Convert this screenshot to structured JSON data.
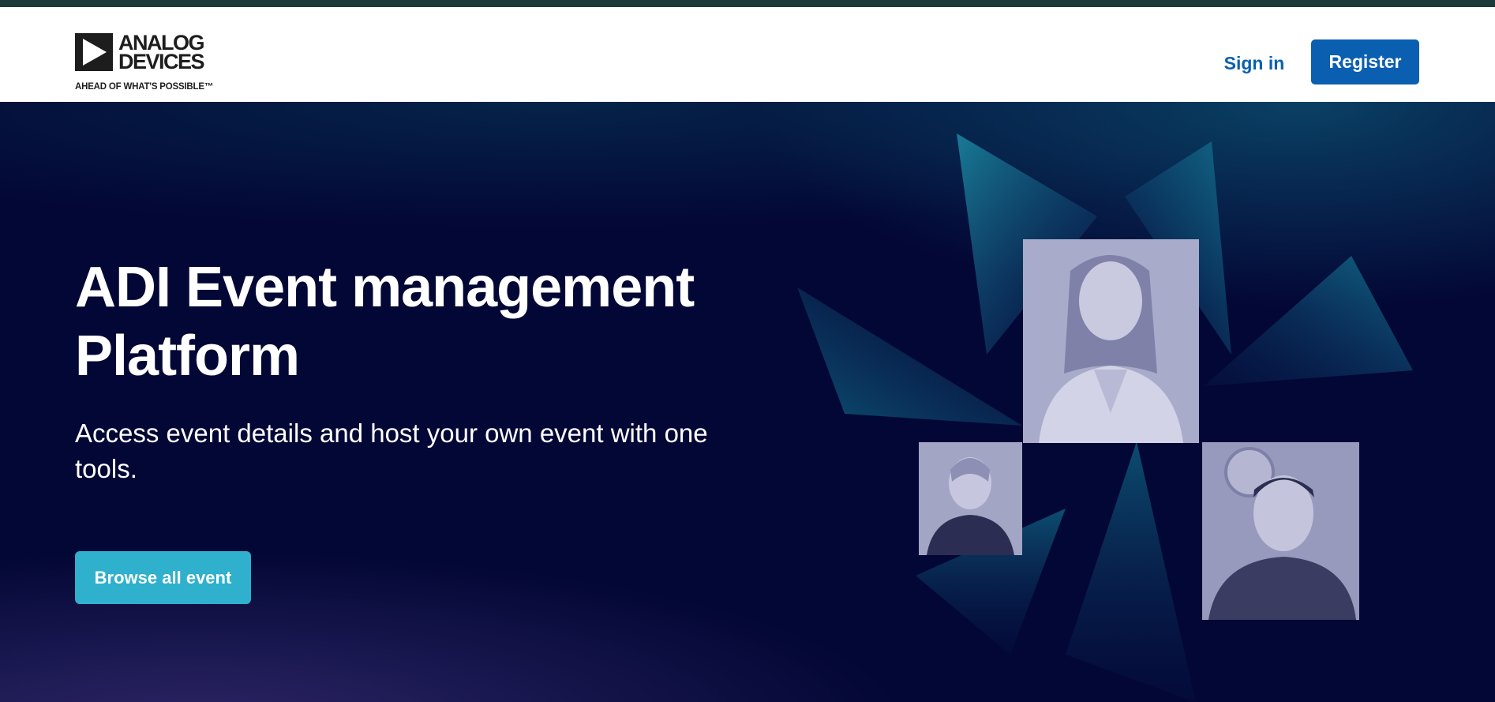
{
  "header": {
    "logo": {
      "line1": "ANALOG",
      "line2": "DEVICES",
      "tagline": "AHEAD OF WHAT'S POSSIBLE™"
    },
    "sign_in_label": "Sign in",
    "register_label": "Register"
  },
  "hero": {
    "title": "ADI Event management Platform",
    "subtitle": "Access event details and host your own event with one tools.",
    "cta_label": "Browse all event"
  },
  "colors": {
    "primary": "#0a5fb0",
    "cta": "#2fb0cc",
    "hero_bg": "#030735",
    "top_strip": "#1b3a3c"
  }
}
